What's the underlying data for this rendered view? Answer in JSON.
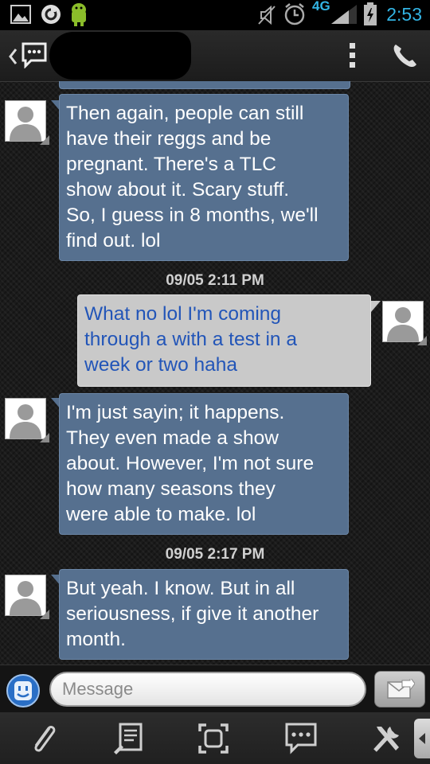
{
  "status_bar": {
    "time": "2:53",
    "network": "4G"
  },
  "action_bar": {
    "contact_name": ""
  },
  "messages": [
    {
      "direction": "in",
      "text": "Then again, people can still\nhave their reggs and be\npregnant.  There's a TLC\nshow about it.  Scary stuff.\nSo, I guess in 8 months, we'll\nfind out.  lol"
    },
    {
      "direction": "stamp",
      "text": "09/05 2:11 PM"
    },
    {
      "direction": "out",
      "text": "What no lol  I'm coming\nthrough a with a test in a\nweek or two haha"
    },
    {
      "direction": "in",
      "text": "I'm just sayin; it happens.\nThey even made a show\nabout.  However, I'm not sure\nhow many seasons they\nwere able to make.  lol"
    },
    {
      "direction": "stamp",
      "text": "09/05 2:17 PM"
    },
    {
      "direction": "in",
      "text": "But yeah.  I know.  But in all\nseriousness, if give it another\nmonth."
    }
  ],
  "composer": {
    "placeholder": "Message"
  },
  "colors": {
    "incoming_bubble": "#56708f",
    "outgoing_bubble": "#c9c9c9",
    "outgoing_text": "#2255b8",
    "accent": "#33b5e5"
  },
  "icons": [
    "gallery-icon",
    "sync-icon",
    "android-icon",
    "mute-icon",
    "alarm-icon",
    "signal-icon",
    "battery-icon",
    "back-icon",
    "messaging-icon",
    "overflow-menu-icon",
    "phone-icon",
    "emoticon-icon",
    "send-icon",
    "attach-icon",
    "compose-icon",
    "screenshot-icon",
    "messages-icon",
    "tools-icon",
    "drawer-handle-icon"
  ]
}
